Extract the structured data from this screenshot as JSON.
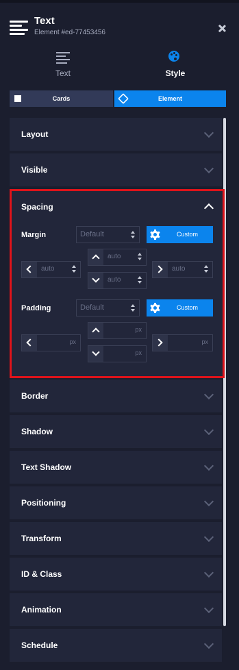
{
  "header": {
    "title": "Text",
    "subtitle": "Element #ed-77453456"
  },
  "mode_tabs": [
    {
      "label": "Text",
      "icon": "align-lines-icon"
    },
    {
      "label": "Style",
      "icon": "palette-icon"
    }
  ],
  "sub_tabs": [
    {
      "label": "Cards",
      "icon": "puzzle-icon"
    },
    {
      "label": "Element",
      "icon": "cube-icon"
    }
  ],
  "panels_top": [
    {
      "title": "Layout"
    },
    {
      "title": "Visible"
    }
  ],
  "spacing": {
    "title": "Spacing",
    "margin": {
      "label": "Margin",
      "select_value": "Default",
      "custom_label": "Custom",
      "top": "auto",
      "left": "auto",
      "right": "auto",
      "bottom": "auto"
    },
    "padding": {
      "label": "Padding",
      "select_value": "Default",
      "custom_label": "Custom",
      "unit": "px"
    }
  },
  "panels_bottom": [
    {
      "title": "Border"
    },
    {
      "title": "Shadow"
    },
    {
      "title": "Text Shadow"
    },
    {
      "title": "Positioning"
    },
    {
      "title": "Transform"
    },
    {
      "title": "ID & Class"
    },
    {
      "title": "Animation"
    },
    {
      "title": "Schedule"
    }
  ],
  "colors": {
    "accent": "#0b84ed",
    "highlight_border": "#e0131a",
    "panel_bg": "#22263a",
    "page_bg": "#1b1e2e"
  }
}
